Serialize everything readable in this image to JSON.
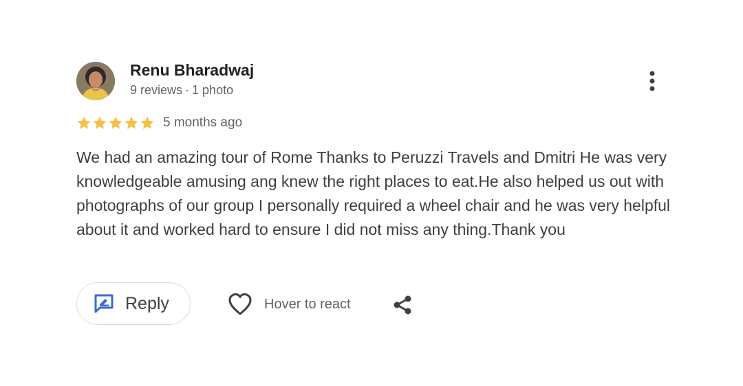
{
  "review": {
    "author": {
      "name": "Renu Bharadwaj",
      "reviews_count": "9 reviews",
      "separator": "·",
      "photos_count": "1 photo"
    },
    "rating": 5,
    "rating_max": 5,
    "date": "5 months ago",
    "text": "We had an amazing tour of Rome Thanks to Peruzzi Travels and Dmitri He was very knowledgeable amusing ang knew the right places to eat.He also helped us out with photographs of our group I personally required a wheel chair and he was very helpful about it and worked hard to ensure I did not miss any thing.Thank you",
    "actions": {
      "reply_label": "Reply",
      "react_label": "Hover to react"
    }
  },
  "icons": {
    "more": "more-vert-icon",
    "star": "star-icon",
    "reply": "reply-edit-icon",
    "react": "heart-icon",
    "share": "share-icon"
  },
  "colors": {
    "star": "#f4c142",
    "reply_icon": "#3c6bd0",
    "name": "#202124",
    "text": "#3c4043",
    "meta": "#5f6368",
    "border": "#dadce0"
  }
}
